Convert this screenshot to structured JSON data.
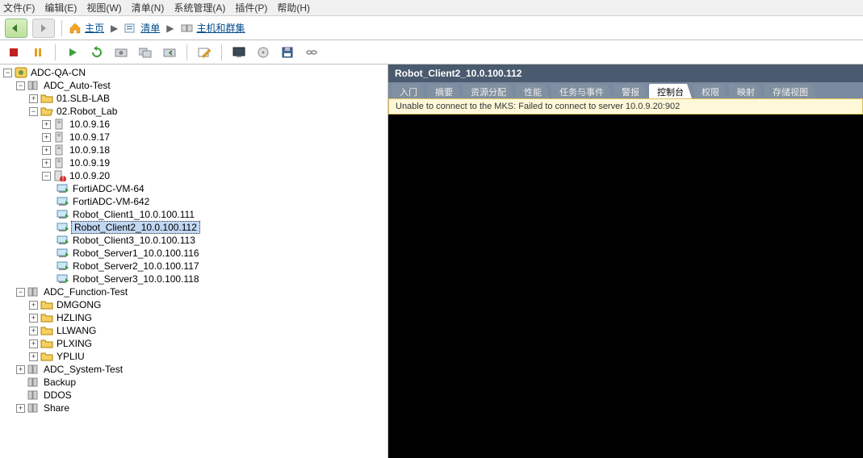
{
  "menubar": [
    "文件(F)",
    "编辑(E)",
    "视图(W)",
    "清单(N)",
    "系统管理(A)",
    "插件(P)",
    "帮助(H)"
  ],
  "breadcrumbs": {
    "home": "主页",
    "inventory": "清单",
    "hosts": "主机和群集"
  },
  "tree": {
    "root": "ADC-QA-CN",
    "autoTest": "ADC_Auto-Test",
    "slb": "01.SLB-LAB",
    "robotLab": "02.Robot_Lab",
    "hosts": [
      "10.0.9.16",
      "10.0.9.17",
      "10.0.9.18",
      "10.0.9.19"
    ],
    "host20": "10.0.9.20",
    "vms": [
      "FortiADC-VM-64",
      "FortiADC-VM-642",
      "Robot_Client1_10.0.100.111",
      "Robot_Client2_10.0.100.112",
      "Robot_Client3_10.0.100.113",
      "Robot_Server1_10.0.100.116",
      "Robot_Server2_10.0.100.117",
      "Robot_Server3_10.0.100.118"
    ],
    "funcTest": "ADC_Function-Test",
    "funcFolders": [
      "DMGONG",
      "HZLING",
      "LLWANG",
      "PLXING",
      "YPLIU"
    ],
    "sysTest": "ADC_System-Test",
    "backup": "Backup",
    "ddos": "DDOS",
    "share": "Share"
  },
  "right": {
    "title": "Robot_Client2_10.0.100.112",
    "tabs": [
      "入门",
      "摘要",
      "资源分配",
      "性能",
      "任务与事件",
      "警报",
      "控制台",
      "权限",
      "映射",
      "存储视图"
    ],
    "consoleMsg": "Unable to connect to the MKS: Failed to connect to server 10.0.9.20:902"
  }
}
